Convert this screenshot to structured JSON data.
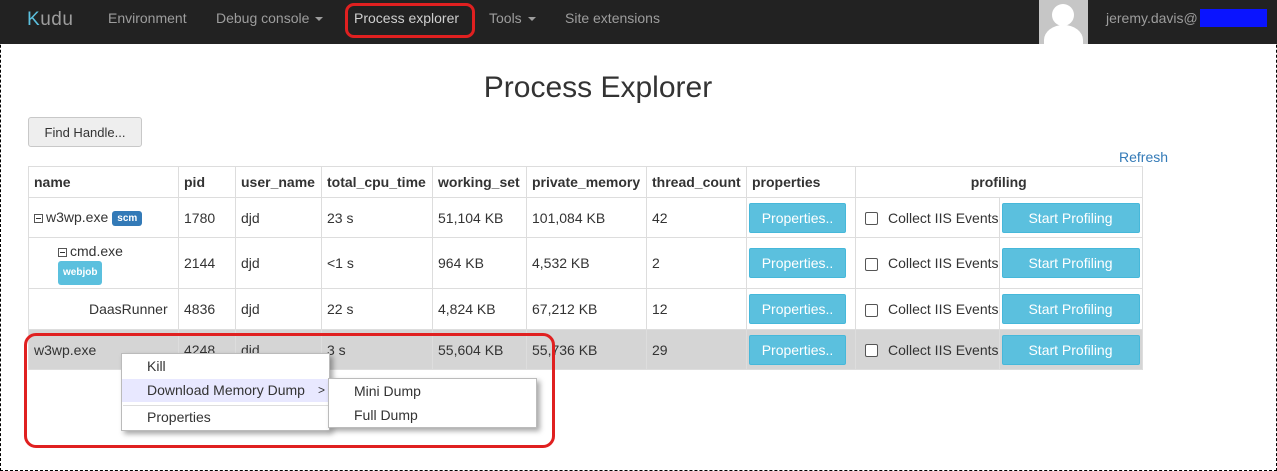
{
  "nav": {
    "brand": "Kudu",
    "items": [
      "Environment",
      "Debug console",
      "Process explorer",
      "Tools",
      "Site extensions"
    ],
    "user": "jeremy.davis@"
  },
  "page": {
    "title": "Process Explorer",
    "find_handle": "Find Handle...",
    "refresh": "Refresh"
  },
  "table": {
    "headers": [
      "name",
      "pid",
      "user_name",
      "total_cpu_time",
      "working_set",
      "private_memory",
      "thread_count",
      "properties",
      "profiling"
    ],
    "rows": [
      {
        "name": "w3wp.exe",
        "badge": "scm",
        "pid": "1780",
        "user": "djd",
        "cpu": "23 s",
        "ws": "51,104 KB",
        "pm": "101,084 KB",
        "tc": "42"
      },
      {
        "name": "cmd.exe",
        "badge": "webjob",
        "pid": "2144",
        "user": "djd",
        "cpu": "<1 s",
        "ws": "964 KB",
        "pm": "4,532 KB",
        "tc": "2"
      },
      {
        "name": "DaasRunner",
        "pid": "4836",
        "user": "djd",
        "cpu": "22 s",
        "ws": "4,824 KB",
        "pm": "67,212 KB",
        "tc": "12"
      },
      {
        "name": "w3wp.exe",
        "pid": "4248",
        "user": "djd",
        "cpu": "3 s",
        "ws": "55,604 KB",
        "pm": "55,736 KB",
        "tc": "29"
      }
    ],
    "properties_btn": "Properties..",
    "collect_label": "Collect IIS Events",
    "start_profiling": "Start Profiling"
  },
  "context_menu": {
    "items": [
      "Kill",
      "Download Memory Dump",
      "Properties"
    ],
    "submenu_arrow": ">",
    "submenu": [
      "Mini Dump",
      "Full Dump"
    ]
  },
  "colors": {
    "navbar": "#222222",
    "info_button": "#5bc0de",
    "badge_scm": "#337ab7",
    "highlight": "#e02020"
  }
}
